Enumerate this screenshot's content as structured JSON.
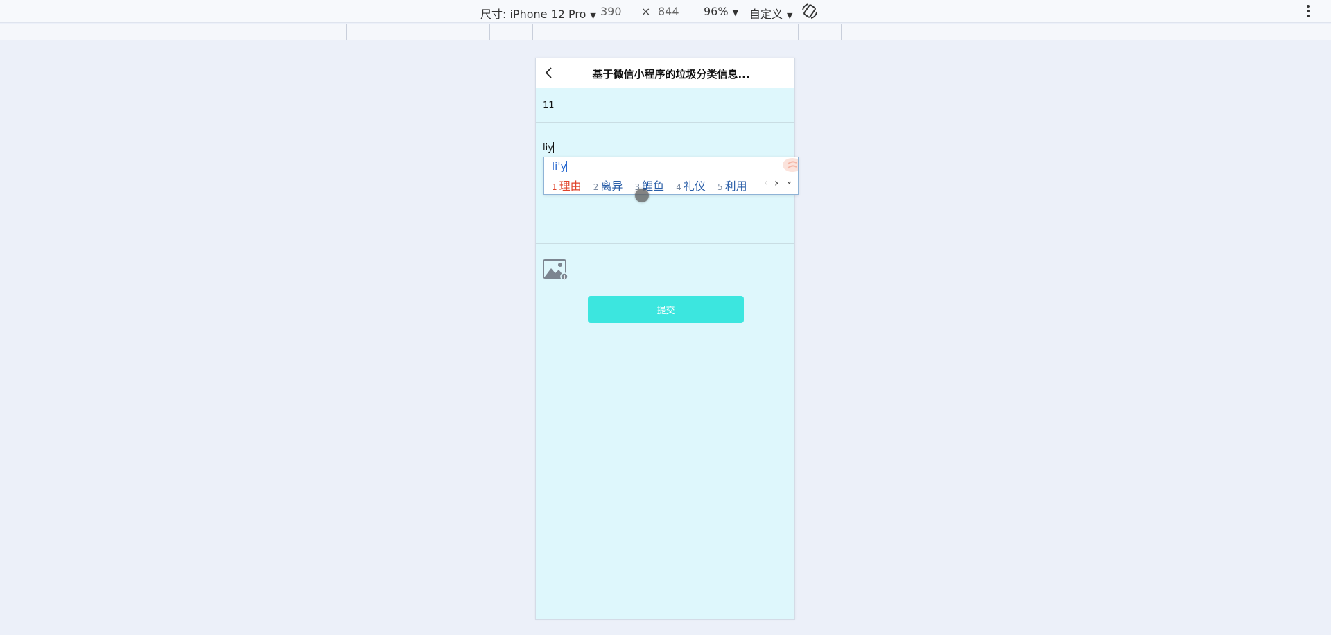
{
  "devtools": {
    "size_label": "尺寸: iPhone 12 Pro",
    "width_value": "390",
    "times_symbol": "×",
    "height_value": "844",
    "zoom_label": "96%",
    "mode_label": "自定义"
  },
  "app": {
    "title": "基于微信小程序的垃圾分类信息...",
    "field1_value": "11",
    "field2_value": "liy",
    "submit_label": "提交",
    "accent_color": "#3ce6df",
    "background_color": "#def7fc"
  },
  "ime": {
    "composition": "li'y",
    "candidates": [
      {
        "num": "1",
        "text": "理由"
      },
      {
        "num": "2",
        "text": "离异"
      },
      {
        "num": "3",
        "text": "鲤鱼"
      },
      {
        "num": "4",
        "text": "礼仪"
      },
      {
        "num": "5",
        "text": "利用"
      }
    ],
    "prev_symbol": "‹",
    "next_symbol": "›",
    "expand_symbol": "⌄"
  }
}
